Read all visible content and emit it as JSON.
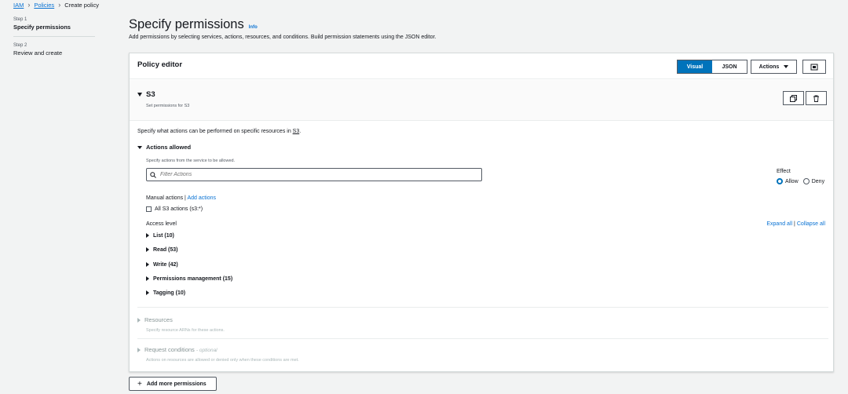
{
  "breadcrumb": {
    "items": [
      "IAM",
      "Policies",
      "Create policy"
    ]
  },
  "steps": [
    {
      "num": "Step 1",
      "title": "Specify permissions"
    },
    {
      "num": "Step 2",
      "title": "Review and create"
    }
  ],
  "page": {
    "title": "Specify permissions",
    "info_label": "Info",
    "subtitle": "Add permissions by selecting services, actions, resources, and conditions. Build permission statements using the JSON editor."
  },
  "editor": {
    "title": "Policy editor",
    "visual_label": "Visual",
    "json_label": "JSON",
    "actions_label": "Actions"
  },
  "service": {
    "name": "S3",
    "subtitle": "Set permissions for S3",
    "spec_prefix": "Specify what actions can be performed on specific resources in ",
    "spec_link": "S3",
    "spec_suffix": ".",
    "actions_allowed": "Actions allowed",
    "actions_hint": "Specify actions from the service to be allowed.",
    "filter_placeholder": "Filter Actions",
    "effect_label": "Effect",
    "allow_label": "Allow",
    "deny_label": "Deny",
    "manual_label": "Manual actions",
    "manual_sep": "|",
    "add_actions_label": "Add actions",
    "all_actions_label": "All S3 actions (s3:*)",
    "access_level_label": "Access level",
    "expand_all": "Expand all",
    "expand_sep": "|",
    "collapse_all": "Collapse all",
    "levels": [
      "List (10)",
      "Read (53)",
      "Write (42)",
      "Permissions management (15)",
      "Tagging (10)"
    ],
    "resources_title": "Resources",
    "resources_hint": "Specify resource ARNs for these actions.",
    "conditions_title": "Request conditions",
    "conditions_optional": "- optional",
    "conditions_hint": "Actions on resources are allowed or denied only when these conditions are met."
  },
  "footer": {
    "add_more_label": "Add more permissions"
  },
  "colors": {
    "accent": "#0073bb",
    "link": "#0972d3",
    "text": "#16191f",
    "muted": "#545b64"
  }
}
